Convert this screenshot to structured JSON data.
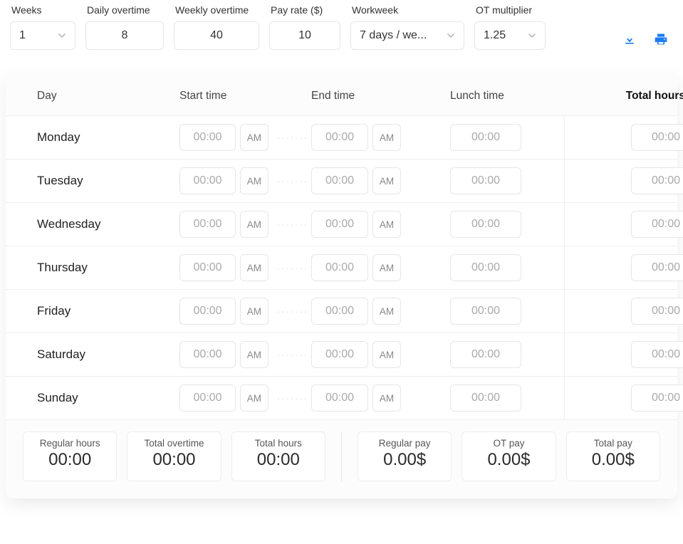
{
  "controls": {
    "weeks": {
      "label": "Weeks",
      "value": "1"
    },
    "dailyOvertime": {
      "label": "Daily overtime",
      "value": "8"
    },
    "weeklyOvertime": {
      "label": "Weekly overtime",
      "value": "40"
    },
    "payRate": {
      "label": "Pay rate ($)",
      "value": "10"
    },
    "workweek": {
      "label": "Workweek",
      "value": "7 days / we..."
    },
    "otMultiplier": {
      "label": "OT multiplier",
      "value": "1.25"
    }
  },
  "table": {
    "headers": {
      "day": "Day",
      "start": "Start time",
      "end": "End time",
      "lunch": "Lunch time",
      "total": "Total hours"
    },
    "rows": [
      {
        "day": "Monday",
        "start": "00:00",
        "startMeridiem": "AM",
        "end": "00:00",
        "endMeridiem": "AM",
        "lunch": "00:00",
        "total": "00:00"
      },
      {
        "day": "Tuesday",
        "start": "00:00",
        "startMeridiem": "AM",
        "end": "00:00",
        "endMeridiem": "AM",
        "lunch": "00:00",
        "total": "00:00"
      },
      {
        "day": "Wednesday",
        "start": "00:00",
        "startMeridiem": "AM",
        "end": "00:00",
        "endMeridiem": "AM",
        "lunch": "00:00",
        "total": "00:00"
      },
      {
        "day": "Thursday",
        "start": "00:00",
        "startMeridiem": "AM",
        "end": "00:00",
        "endMeridiem": "AM",
        "lunch": "00:00",
        "total": "00:00"
      },
      {
        "day": "Friday",
        "start": "00:00",
        "startMeridiem": "AM",
        "end": "00:00",
        "endMeridiem": "AM",
        "lunch": "00:00",
        "total": "00:00"
      },
      {
        "day": "Saturday",
        "start": "00:00",
        "startMeridiem": "AM",
        "end": "00:00",
        "endMeridiem": "AM",
        "lunch": "00:00",
        "total": "00:00"
      },
      {
        "day": "Sunday",
        "start": "00:00",
        "startMeridiem": "AM",
        "end": "00:00",
        "endMeridiem": "AM",
        "lunch": "00:00",
        "total": "00:00"
      }
    ]
  },
  "summary": {
    "regularHours": {
      "label": "Regular hours",
      "value": "00:00"
    },
    "totalOT": {
      "label": "Total overtime",
      "value": "00:00"
    },
    "totalHours": {
      "label": "Total hours",
      "value": "00:00"
    },
    "regularPay": {
      "label": "Regular pay",
      "value": "0.00$"
    },
    "otPay": {
      "label": "OT pay",
      "value": "0.00$"
    },
    "totalPay": {
      "label": "Total pay",
      "value": "0.00$"
    }
  }
}
